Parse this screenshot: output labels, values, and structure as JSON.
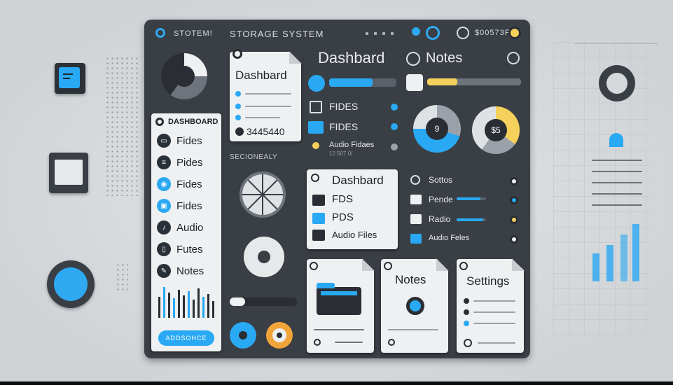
{
  "header": {
    "logo_text": "STOTEM!",
    "title": "STORAGE SYSTEM",
    "code": "$00573F"
  },
  "sidebar": {
    "title": "DASHBOARD",
    "items": [
      {
        "label": "Fides",
        "icon": "folder-icon"
      },
      {
        "label": "Pides",
        "icon": "list-icon"
      },
      {
        "label": "Fides",
        "icon": "disc-icon"
      },
      {
        "label": "Fides",
        "icon": "box-icon"
      },
      {
        "label": "Audio",
        "icon": "audio-icon"
      },
      {
        "label": "Futes",
        "icon": "file-icon"
      },
      {
        "label": "Notes",
        "icon": "notes-icon"
      }
    ],
    "button_label": "ADDSOHCE"
  },
  "dashboard_card": {
    "title": "Dashbard",
    "number": "3445440"
  },
  "section_label": "SECIONEALY",
  "main": {
    "title": "Dashbard",
    "notes_title": "Notes",
    "rows": [
      {
        "label": "FIDES"
      },
      {
        "label": "FIDES"
      },
      {
        "label": "Audio Fidaes",
        "sub": "12 507 0/"
      }
    ],
    "pie_1_label": "9",
    "pie_2_label": "$5"
  },
  "list_card": {
    "title": "Dashbard",
    "items": [
      "FDS",
      "PDS",
      "Audio Files"
    ]
  },
  "right_list": {
    "items": [
      "Sottos",
      "Pende",
      "Radio",
      "Audio Feles"
    ]
  },
  "bottom_cards": {
    "notes_title": "Notes",
    "settings_title": "Settings"
  },
  "colors": {
    "accent": "#29a9f3",
    "panel": "#3a3e45",
    "paper": "#eef0f1",
    "yellow": "#f5d15c",
    "orange": "#f0a43a"
  }
}
